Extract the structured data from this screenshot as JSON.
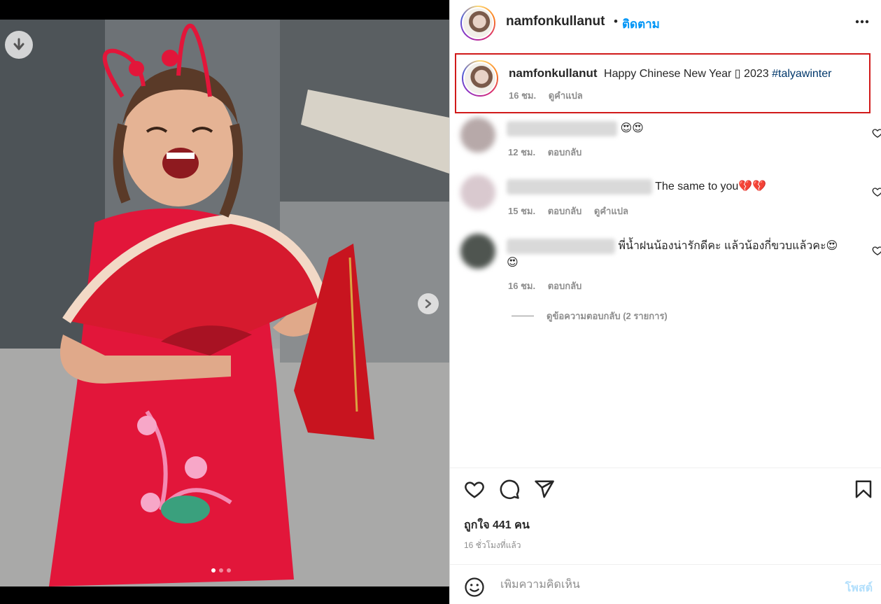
{
  "post": {
    "carousel": {
      "slides": 3,
      "active_slide": 1
    },
    "download_icon": "arrow-down-circle-icon",
    "next_icon": "chevron-right-icon"
  },
  "header": {
    "username": "namfonkullanut",
    "separator": "•",
    "follow_label": "ติดตาม",
    "more_icon": "more-horizontal-icon"
  },
  "caption": {
    "username": "namfonkullanut",
    "text": "Happy Chinese New Year ▯ 2023",
    "hashtag": "#talyawinter",
    "time": "16 ชม.",
    "translate_label": "ดูคำแปล"
  },
  "comments": [
    {
      "text": "😍😍",
      "time": "12 ชม.",
      "reply_label": "ตอบกลับ",
      "translate_label": ""
    },
    {
      "text": "The same to you💔💔",
      "time": "15 ชม.",
      "reply_label": "ตอบกลับ",
      "translate_label": "ดูคำแปล"
    },
    {
      "text": "พี่น้ำฝนน้องน่ารักดีคะ แล้วน้องกี่ขวบแล้วคะ😍",
      "text2": "😍",
      "time": "16 ชม.",
      "reply_label": "ตอบกลับ",
      "translate_label": ""
    }
  ],
  "view_replies_label": "ดูข้อความตอบกลับ (2 รายการ)",
  "actions": {
    "like_icon": "heart-icon",
    "comment_icon": "comment-icon",
    "share_icon": "send-icon",
    "save_icon": "bookmark-icon"
  },
  "likes_label": "ถูกใจ 441 คน",
  "time_ago": "16 ชั่วโมงที่แล้ว",
  "comment_box": {
    "placeholder": "เพิ่มความคิดเห็น",
    "post_label": "โพสต์",
    "emoji_icon": "smiley-icon"
  },
  "colors": {
    "accent": "#0095f6",
    "highlight_border": "#d11a1a",
    "hashtag": "#00376b",
    "muted": "#8e8e8e"
  }
}
